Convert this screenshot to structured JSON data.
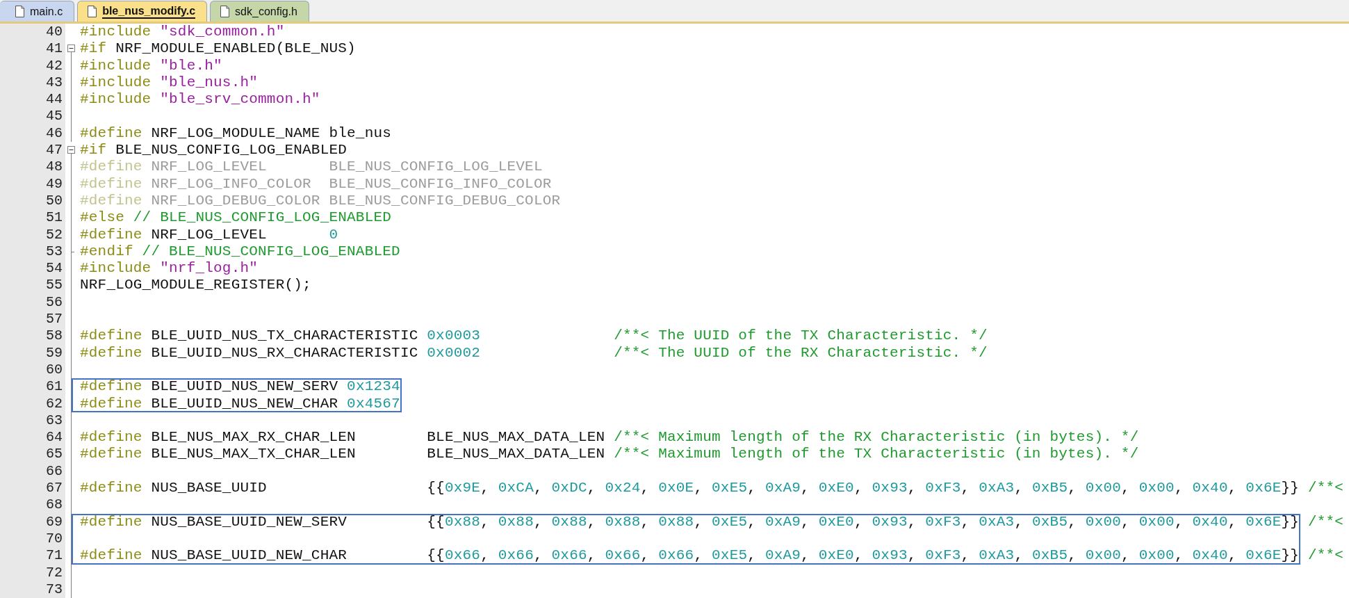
{
  "tabs": [
    {
      "label": "main.c",
      "selected": false,
      "color": "#c9d6ef"
    },
    {
      "label": "ble_nus_modify.c",
      "selected": true,
      "color": "#fbe08c"
    },
    {
      "label": "sdk_config.h",
      "selected": false,
      "color": "#c5d7a8"
    }
  ],
  "editor": {
    "blocks": [
      {
        "kind": "line",
        "number": "40",
        "in_fold": false,
        "tokens": [
          {
            "kind": "pp",
            "text": "#include"
          },
          {
            "kind": "str",
            "text": " \"sdk_common.h\""
          }
        ]
      },
      {
        "kind": "line",
        "number": "41",
        "fold_start": true,
        "tokens": [
          {
            "kind": "pp",
            "text": "#if"
          },
          {
            "kind": "id",
            "text": " NRF_MODULE_ENABLED(BLE_NUS)"
          }
        ]
      },
      {
        "kind": "line",
        "number": "42",
        "tokens": [
          {
            "kind": "pp",
            "text": "#include"
          },
          {
            "kind": "str",
            "text": " \"ble.h\""
          }
        ]
      },
      {
        "kind": "line",
        "number": "43",
        "tokens": [
          {
            "kind": "pp",
            "text": "#include"
          },
          {
            "kind": "str",
            "text": " \"ble_nus.h\""
          }
        ]
      },
      {
        "kind": "line",
        "number": "44",
        "tokens": [
          {
            "kind": "pp",
            "text": "#include"
          },
          {
            "kind": "str",
            "text": " \"ble_srv_common.h\""
          }
        ]
      },
      {
        "kind": "line",
        "number": "45"
      },
      {
        "kind": "line",
        "number": "46",
        "tokens": [
          {
            "kind": "pp",
            "text": "#define"
          },
          {
            "kind": "id",
            "text": " NRF_LOG_MODULE_NAME ble_nus"
          }
        ]
      },
      {
        "kind": "line",
        "number": "47",
        "fold_start": true,
        "tokens": [
          {
            "kind": "pp",
            "text": "#if"
          },
          {
            "kind": "id",
            "text": " BLE_NUS_CONFIG_LOG_ENABLED"
          }
        ]
      },
      {
        "kind": "line",
        "number": "48",
        "tokens": [
          {
            "kind": "offpp",
            "text": "#define"
          },
          {
            "kind": "off",
            "text": " NRF_LOG_LEVEL       BLE_NUS_CONFIG_LOG_LEVEL"
          }
        ]
      },
      {
        "kind": "line",
        "number": "49",
        "tokens": [
          {
            "kind": "offpp",
            "text": "#define"
          },
          {
            "kind": "off",
            "text": " NRF_LOG_INFO_COLOR  BLE_NUS_CONFIG_INFO_COLOR"
          }
        ]
      },
      {
        "kind": "line",
        "number": "50",
        "tokens": [
          {
            "kind": "offpp",
            "text": "#define"
          },
          {
            "kind": "off",
            "text": " NRF_LOG_DEBUG_COLOR BLE_NUS_CONFIG_DEBUG_COLOR"
          }
        ]
      },
      {
        "kind": "line",
        "number": "51",
        "tokens": [
          {
            "kind": "pp",
            "text": "#else"
          },
          {
            "kind": "cm",
            "text": " // BLE_NUS_CONFIG_LOG_ENABLED"
          }
        ]
      },
      {
        "kind": "line",
        "number": "52",
        "tokens": [
          {
            "kind": "pp",
            "text": "#define"
          },
          {
            "kind": "id",
            "text": " NRF_LOG_LEVEL       "
          },
          {
            "kind": "num",
            "text": "0"
          }
        ]
      },
      {
        "kind": "line",
        "number": "53",
        "fold_end": true,
        "tokens": [
          {
            "kind": "pp",
            "text": "#endif"
          },
          {
            "kind": "cm",
            "text": " // BLE_NUS_CONFIG_LOG_ENABLED"
          }
        ]
      },
      {
        "kind": "line",
        "number": "54",
        "tokens": [
          {
            "kind": "pp",
            "text": "#include"
          },
          {
            "kind": "str",
            "text": " \"nrf_log.h\""
          }
        ]
      },
      {
        "kind": "line",
        "number": "55",
        "tokens": [
          {
            "kind": "id",
            "text": "NRF_LOG_MODULE_REGISTER();"
          }
        ]
      },
      {
        "kind": "line",
        "number": "56"
      },
      {
        "kind": "line",
        "number": "57"
      },
      {
        "kind": "line",
        "number": "58",
        "tokens": [
          {
            "kind": "pp",
            "text": "#define"
          },
          {
            "kind": "id",
            "text": " BLE_UUID_NUS_TX_CHARACTERISTIC "
          },
          {
            "kind": "num",
            "text": "0x0003"
          },
          {
            "kind": "cm",
            "text": "               /**< The UUID of the TX Characteristic. */"
          }
        ]
      },
      {
        "kind": "line",
        "number": "59",
        "tokens": [
          {
            "kind": "pp",
            "text": "#define"
          },
          {
            "kind": "id",
            "text": " BLE_UUID_NUS_RX_CHARACTERISTIC "
          },
          {
            "kind": "num",
            "text": "0x0002"
          },
          {
            "kind": "cm",
            "text": "               /**< The UUID of the RX Characteristic. */"
          }
        ]
      },
      {
        "kind": "line",
        "number": "60"
      },
      {
        "kind": "box",
        "lines": [
          {
            "number": "61",
            "tokens": [
              {
                "kind": "pp",
                "text": "#define"
              },
              {
                "kind": "id",
                "text": " BLE_UUID_NUS_NEW_SERV "
              },
              {
                "kind": "num",
                "text": "0x1234"
              }
            ]
          },
          {
            "number": "62",
            "tokens": [
              {
                "kind": "pp",
                "text": "#define"
              },
              {
                "kind": "id",
                "text": " BLE_UUID_NUS_NEW_CHAR "
              },
              {
                "kind": "num",
                "text": "0x4567"
              }
            ]
          }
        ]
      },
      {
        "kind": "line",
        "number": "63"
      },
      {
        "kind": "line",
        "number": "64",
        "tokens": [
          {
            "kind": "pp",
            "text": "#define"
          },
          {
            "kind": "id",
            "text": " BLE_NUS_MAX_RX_CHAR_LEN        BLE_NUS_MAX_DATA_LEN"
          },
          {
            "kind": "cm",
            "text": " /**< Maximum length of the RX Characteristic (in bytes). */"
          }
        ]
      },
      {
        "kind": "line",
        "number": "65",
        "tokens": [
          {
            "kind": "pp",
            "text": "#define"
          },
          {
            "kind": "id",
            "text": " BLE_NUS_MAX_TX_CHAR_LEN        BLE_NUS_MAX_DATA_LEN"
          },
          {
            "kind": "cm",
            "text": " /**< Maximum length of the TX Characteristic (in bytes). */"
          }
        ]
      },
      {
        "kind": "line",
        "number": "66"
      },
      {
        "kind": "line",
        "number": "67",
        "tokens": [
          {
            "kind": "pp",
            "text": "#define"
          },
          {
            "kind": "id",
            "text": " NUS_BASE_UUID                  "
          },
          {
            "kind": "array",
            "text": "{{0x9E, 0xCA, 0xDC, 0x24, 0x0E, 0xE5, 0xA9, 0xE0, 0x93, 0xF3, 0xA3, 0xB5, 0x00, 0x00, 0x40, 0x6E}}"
          },
          {
            "kind": "cm",
            "text": " /**<"
          }
        ]
      },
      {
        "kind": "line",
        "number": "68"
      },
      {
        "kind": "box",
        "lines": [
          {
            "number": "69",
            "tokens": [
              {
                "kind": "pp",
                "text": "#define"
              },
              {
                "kind": "id",
                "text": " NUS_BASE_UUID_NEW_SERV         "
              },
              {
                "kind": "array",
                "text": "{{0x88, 0x88, 0x88, 0x88, 0x88, 0xE5, 0xA9, 0xE0, 0x93, 0xF3, 0xA3, 0xB5, 0x00, 0x00, 0x40, 0x6E}}"
              },
              {
                "kind": "cm",
                "text": " /**<"
              }
            ]
          },
          {
            "number": "70"
          },
          {
            "number": "71",
            "tokens": [
              {
                "kind": "pp",
                "text": "#define"
              },
              {
                "kind": "id",
                "text": " NUS_BASE_UUID_NEW_CHAR         "
              },
              {
                "kind": "array",
                "text": "{{0x66, 0x66, 0x66, 0x66, 0x66, 0xE5, 0xA9, 0xE0, 0x93, 0xF3, 0xA3, 0xB5, 0x00, 0x00, 0x40, 0x6E}}"
              },
              {
                "kind": "cm",
                "text": " /**<"
              }
            ]
          }
        ]
      },
      {
        "kind": "line",
        "number": "72"
      },
      {
        "kind": "line",
        "number": "73"
      }
    ]
  }
}
